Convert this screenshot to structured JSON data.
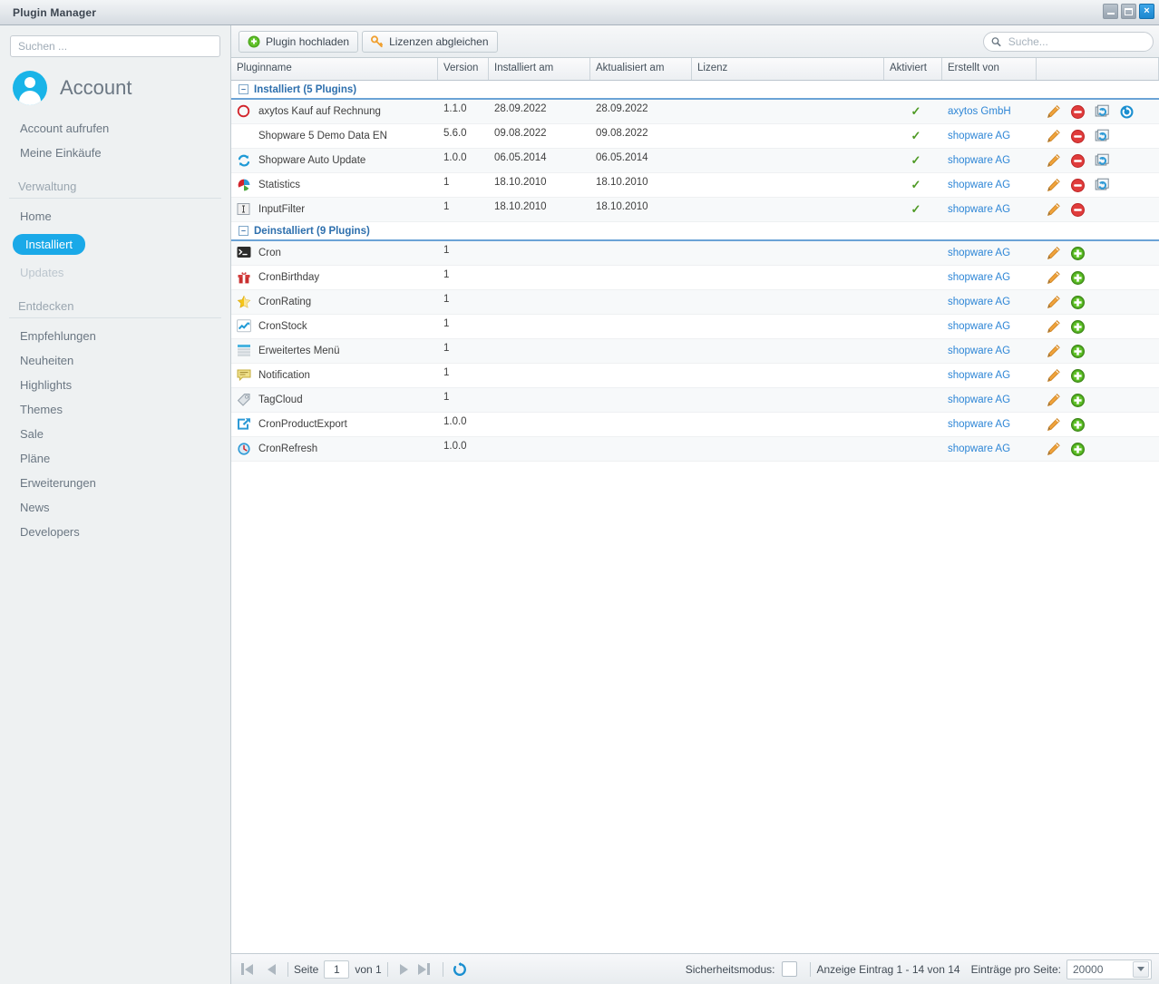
{
  "window": {
    "title": "Plugin Manager",
    "buttons": {
      "minimize": "minimize-button",
      "maximize": "maximize-button",
      "close": "×"
    }
  },
  "sidebar": {
    "search_placeholder": "Suchen ...",
    "search_value": "",
    "account_label": "Account",
    "account_links": [
      {
        "label": "Account aufrufen"
      },
      {
        "label": "Meine Einkäufe"
      }
    ],
    "sections": [
      {
        "title": "Verwaltung",
        "items": [
          {
            "label": "Home",
            "state": "normal"
          },
          {
            "label": "Installiert",
            "state": "active"
          },
          {
            "label": "Updates",
            "state": "disabled"
          }
        ]
      },
      {
        "title": "Entdecken",
        "items": [
          {
            "label": "Empfehlungen",
            "state": "normal"
          },
          {
            "label": "Neuheiten",
            "state": "normal"
          },
          {
            "label": "Highlights",
            "state": "normal"
          },
          {
            "label": "Themes",
            "state": "normal"
          },
          {
            "label": "Sale",
            "state": "normal"
          },
          {
            "label": "Pläne",
            "state": "normal"
          },
          {
            "label": "Erweiterungen",
            "state": "normal"
          },
          {
            "label": "News",
            "state": "normal"
          },
          {
            "label": "Developers",
            "state": "normal"
          }
        ]
      }
    ]
  },
  "toolbar": {
    "upload_label": "Plugin hochladen",
    "licenses_label": "Lizenzen abgleichen",
    "search_placeholder": "Suche...",
    "search_value": ""
  },
  "grid": {
    "columns": [
      {
        "label": "Pluginname"
      },
      {
        "label": "Version"
      },
      {
        "label": "Installiert am"
      },
      {
        "label": "Aktualisiert am"
      },
      {
        "label": "Lizenz"
      },
      {
        "label": "Aktiviert"
      },
      {
        "label": "Erstellt von"
      },
      {
        "label": ""
      }
    ],
    "groups": [
      {
        "title": "Installiert (5 Plugins)",
        "rows": [
          {
            "icon": "red-circle-icon",
            "name": "axytos Kauf auf Rechnung",
            "version": "1.1.0",
            "installed": "28.09.2022",
            "updated": "28.09.2022",
            "license": "",
            "active": "✓",
            "vendor": "axytos GmbH",
            "actions": [
              "edit-icon",
              "deactivate-icon",
              "reinstall-icon",
              "refresh-icon"
            ]
          },
          {
            "icon": "none",
            "name": "Shopware 5 Demo Data EN",
            "version": "5.6.0",
            "installed": "09.08.2022",
            "updated": "09.08.2022",
            "license": "",
            "active": "✓",
            "vendor": "shopware AG",
            "actions": [
              "edit-icon",
              "deactivate-icon",
              "reinstall-icon"
            ]
          },
          {
            "icon": "sync-arrows-icon",
            "name": "Shopware Auto Update",
            "version": "1.0.0",
            "installed": "06.05.2014",
            "updated": "06.05.2014",
            "license": "",
            "active": "✓",
            "vendor": "shopware AG",
            "actions": [
              "edit-icon",
              "deactivate-icon",
              "reinstall-icon"
            ]
          },
          {
            "icon": "pie-chart-icon",
            "name": "Statistics",
            "version": "1",
            "installed": "18.10.2010",
            "updated": "18.10.2010",
            "license": "",
            "active": "✓",
            "vendor": "shopware AG",
            "actions": [
              "edit-icon",
              "deactivate-icon",
              "reinstall-icon"
            ]
          },
          {
            "icon": "textfield-icon",
            "name": "InputFilter",
            "version": "1",
            "installed": "18.10.2010",
            "updated": "18.10.2010",
            "license": "",
            "active": "✓",
            "vendor": "shopware AG",
            "actions": [
              "edit-icon",
              "deactivate-icon"
            ]
          }
        ]
      },
      {
        "title": "Deinstalliert (9 Plugins)",
        "rows": [
          {
            "icon": "console-icon",
            "name": "Cron",
            "version": "1",
            "installed": "",
            "updated": "",
            "license": "",
            "active": "",
            "vendor": "shopware AG",
            "actions": [
              "edit-icon",
              "install-icon"
            ]
          },
          {
            "icon": "gift-icon",
            "name": "CronBirthday",
            "version": "1",
            "installed": "",
            "updated": "",
            "license": "",
            "active": "",
            "vendor": "shopware AG",
            "actions": [
              "edit-icon",
              "install-icon"
            ]
          },
          {
            "icon": "star-icon",
            "name": "CronRating",
            "version": "1",
            "installed": "",
            "updated": "",
            "license": "",
            "active": "",
            "vendor": "shopware AG",
            "actions": [
              "edit-icon",
              "install-icon"
            ]
          },
          {
            "icon": "chart-arrow-icon",
            "name": "CronStock",
            "version": "1",
            "installed": "",
            "updated": "",
            "license": "",
            "active": "",
            "vendor": "shopware AG",
            "actions": [
              "edit-icon",
              "install-icon"
            ]
          },
          {
            "icon": "menu-list-icon",
            "name": "Erweitertes Menü",
            "version": "1",
            "installed": "",
            "updated": "",
            "license": "",
            "active": "",
            "vendor": "shopware AG",
            "actions": [
              "edit-icon",
              "install-icon"
            ]
          },
          {
            "icon": "speech-bubble-icon",
            "name": "Notification",
            "version": "1",
            "installed": "",
            "updated": "",
            "license": "",
            "active": "",
            "vendor": "shopware AG",
            "actions": [
              "edit-icon",
              "install-icon"
            ]
          },
          {
            "icon": "tag-icon",
            "name": "TagCloud",
            "version": "1",
            "installed": "",
            "updated": "",
            "license": "",
            "active": "",
            "vendor": "shopware AG",
            "actions": [
              "edit-icon",
              "install-icon"
            ]
          },
          {
            "icon": "export-arrow-icon",
            "name": "CronProductExport",
            "version": "1.0.0",
            "installed": "",
            "updated": "",
            "license": "",
            "active": "",
            "vendor": "shopware AG",
            "actions": [
              "edit-icon",
              "install-icon"
            ]
          },
          {
            "icon": "clock-icon",
            "name": "CronRefresh",
            "version": "1.0.0",
            "installed": "",
            "updated": "",
            "license": "",
            "active": "",
            "vendor": "shopware AG",
            "actions": [
              "edit-icon",
              "install-icon"
            ]
          }
        ]
      }
    ]
  },
  "footer": {
    "page_label": "Seite",
    "page_value": "1",
    "of_label": "von 1",
    "safe_mode_label": "Sicherheitsmodus:",
    "safe_mode_checked": false,
    "display_range": "Anzeige Eintrag 1 - 14 von 14",
    "per_page_label": "Einträge pro Seite:",
    "per_page_value": "20000"
  },
  "colors": {
    "accent": "#1aa9e8",
    "link": "#2e86d6",
    "group_header": "#2d6fad",
    "check_green": "#4e9a24",
    "deactivate_red": "#e24a4a",
    "install_green": "#4ea81e",
    "edit_orange": "#e8913a"
  }
}
